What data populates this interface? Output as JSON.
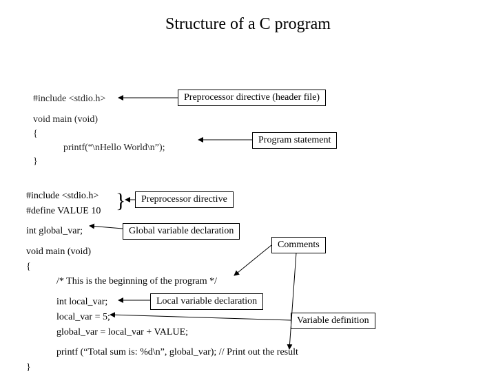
{
  "title": "Structure of a C program",
  "example1": {
    "line1": "#include <stdio.h>",
    "line2": "void main (void)",
    "line3": "{",
    "line4": "printf(“\\nHello World\\n”);",
    "line5": "}"
  },
  "example2": {
    "line1": "#include <stdio.h>",
    "line2": "#define VALUE 10",
    "line3": "int global_var;",
    "line4": "void main (void)",
    "line5": "{",
    "line6": "/* This is the beginning of the program */",
    "line7": "int local_var;",
    "line8": "local_var = 5;",
    "line9": "global_var = local_var + VALUE;",
    "line10": "printf (“Total sum is: %d\\n”, global_var); // Print out the result",
    "line11": "}"
  },
  "labels": {
    "preprocessor_header": "Preprocessor directive (header file)",
    "program_statement": "Program statement",
    "preprocessor": "Preprocessor directive",
    "global_var": "Global variable declaration",
    "comments": "Comments",
    "local_var": "Local variable declaration",
    "variable_def": "Variable definition"
  },
  "brace": "}"
}
